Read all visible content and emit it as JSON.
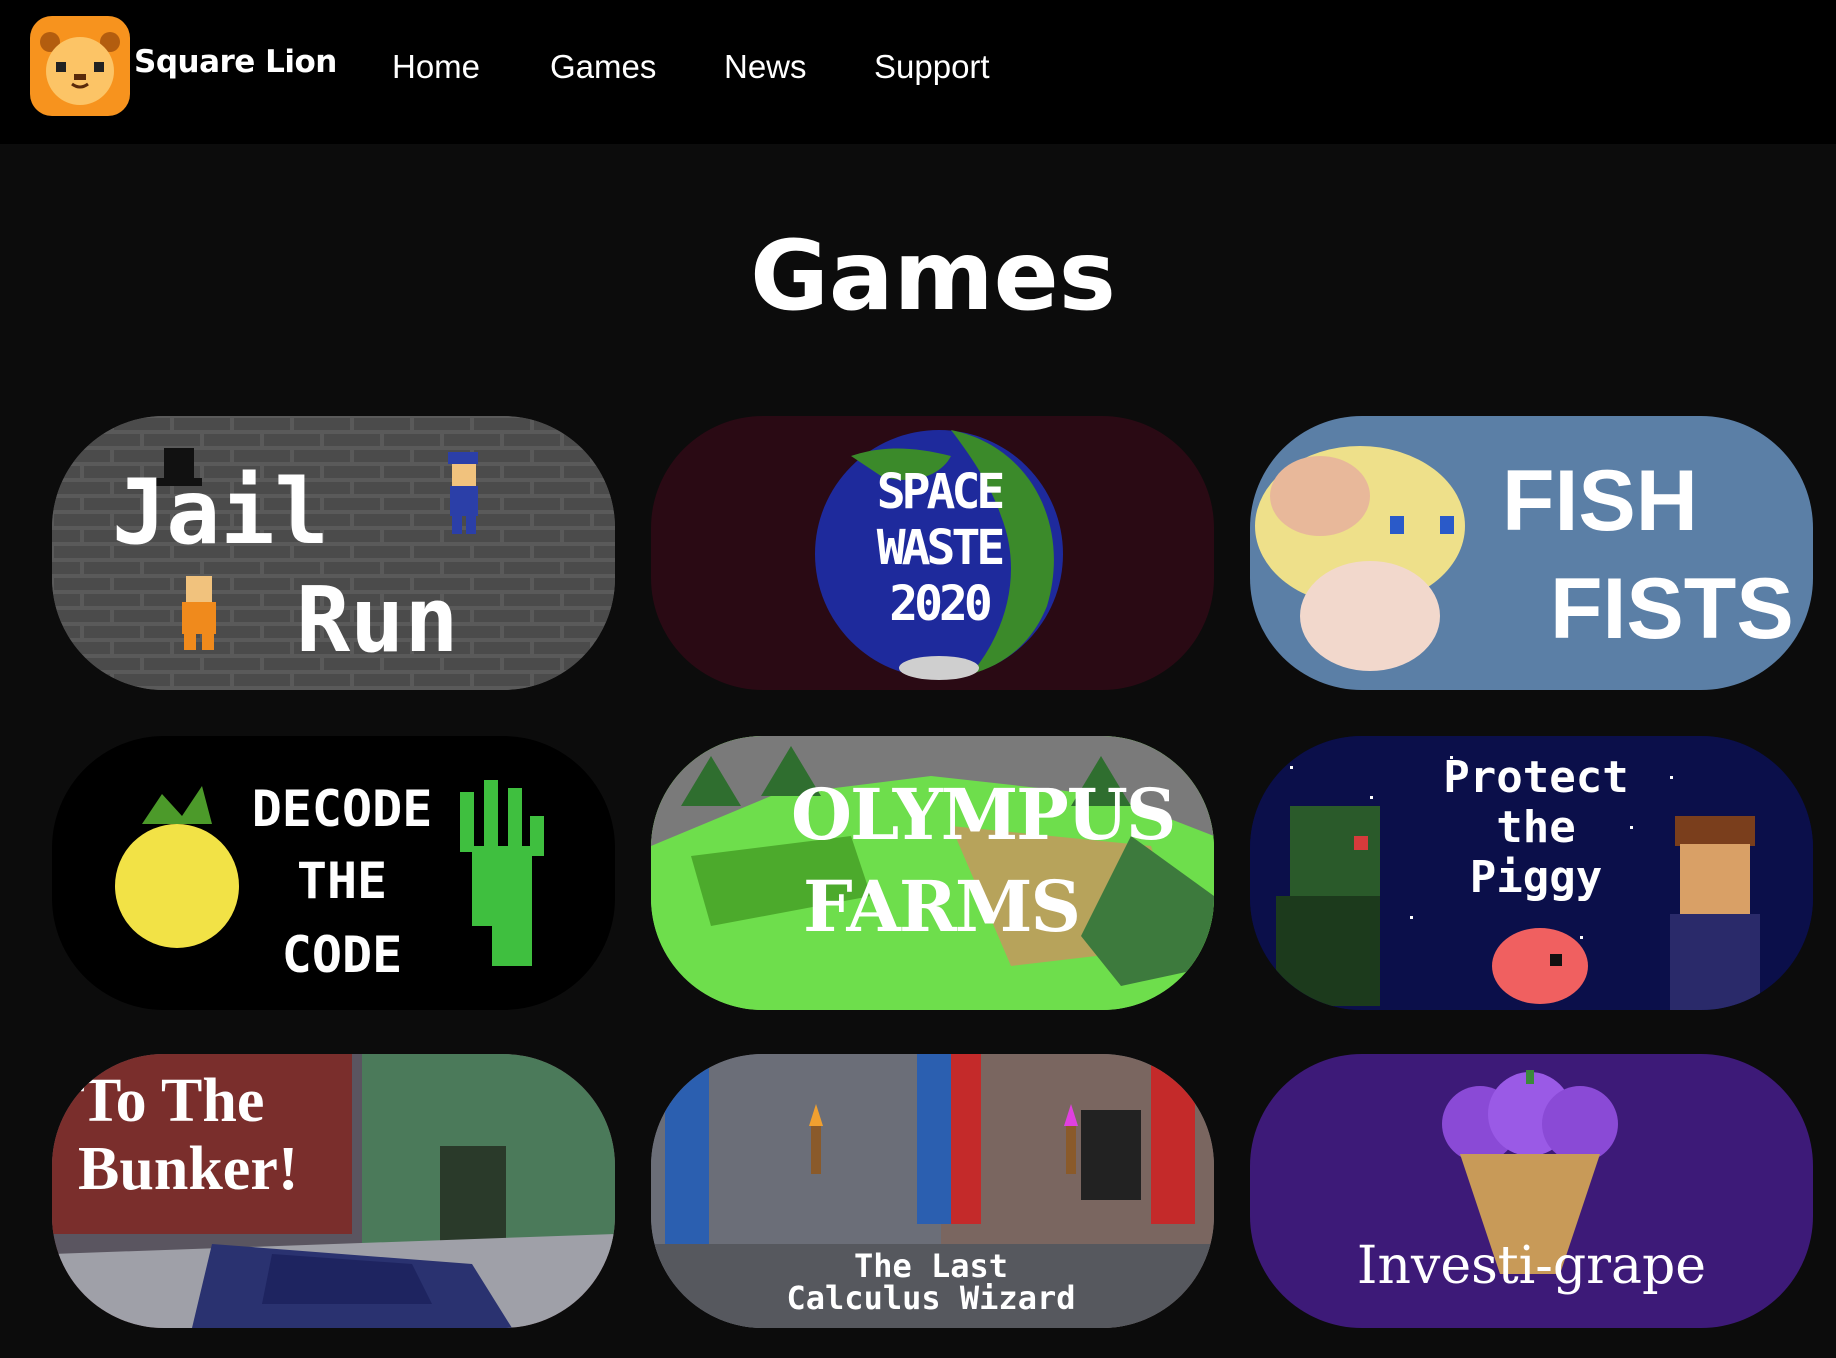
{
  "nav": {
    "brand": "Square Lion",
    "links": [
      "Home",
      "Games",
      "News",
      "Support"
    ]
  },
  "page": {
    "title": "Games"
  },
  "games": [
    {
      "title_line1": "Jail",
      "title_line2": "Run",
      "bg_color": "#555555"
    },
    {
      "title_line1": "SPACE",
      "title_line2": "WASTE",
      "title_line3": "2020",
      "bg_color": "#2a0a14"
    },
    {
      "title_line1": "FISH",
      "title_line2": "FISTS",
      "bg_color": "#5b7fa6"
    },
    {
      "title_line1": "DECODE",
      "title_line2": "THE",
      "title_line3": "CODE",
      "bg_color": "#000000"
    },
    {
      "title_line1": "OLYMPUS",
      "title_line2": "FARMS",
      "bg_color": "#6ede4c"
    },
    {
      "title_line1": "Protect",
      "title_line2": "the",
      "title_line3": "Piggy",
      "bg_color": "#0b0f4a"
    },
    {
      "title_line1": "To The",
      "title_line2": "Bunker!",
      "bg_color": "#7a2e2c"
    },
    {
      "title_line1": "The Last",
      "title_line2": "Calculus Wizard",
      "bg_color": "#6b6e78"
    },
    {
      "title": "Investi-grape",
      "bg_color": "#3d1a78"
    }
  ],
  "colors": {
    "accent": "#f7931e",
    "nav_bg": "#000000",
    "page_bg": "#0c0c0c"
  }
}
